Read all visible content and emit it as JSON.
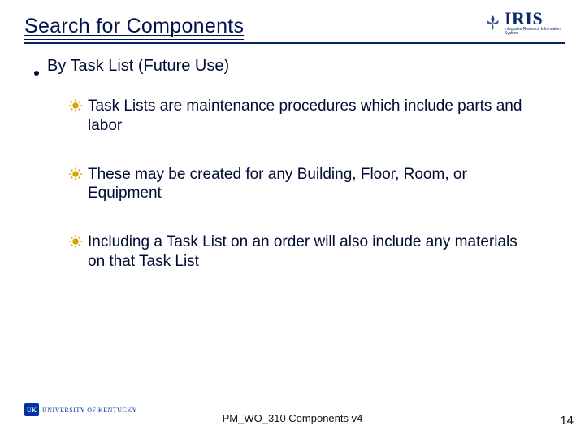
{
  "title": "Search for Components",
  "bullet_lvl1": "By Task List (Future Use)",
  "bullets_lvl2": [
    "Task Lists are maintenance procedures which include parts and labor",
    "These may be created for any Building, Floor, Room, or Equipment",
    "Including a Task List on an order will also include any materials on that Task List"
  ],
  "logo": {
    "text": "IRIS",
    "tagline": "Integrated Resource Information System"
  },
  "footer": {
    "uk_mark": "UK",
    "uk_text": "UNIVERSITY OF KENTUCKY",
    "center": "PM_WO_310 Components v4",
    "page": "14"
  },
  "colors": {
    "accent_navy": "#00114d",
    "bullet_gold": "#d9a400",
    "rule": "#052563"
  }
}
